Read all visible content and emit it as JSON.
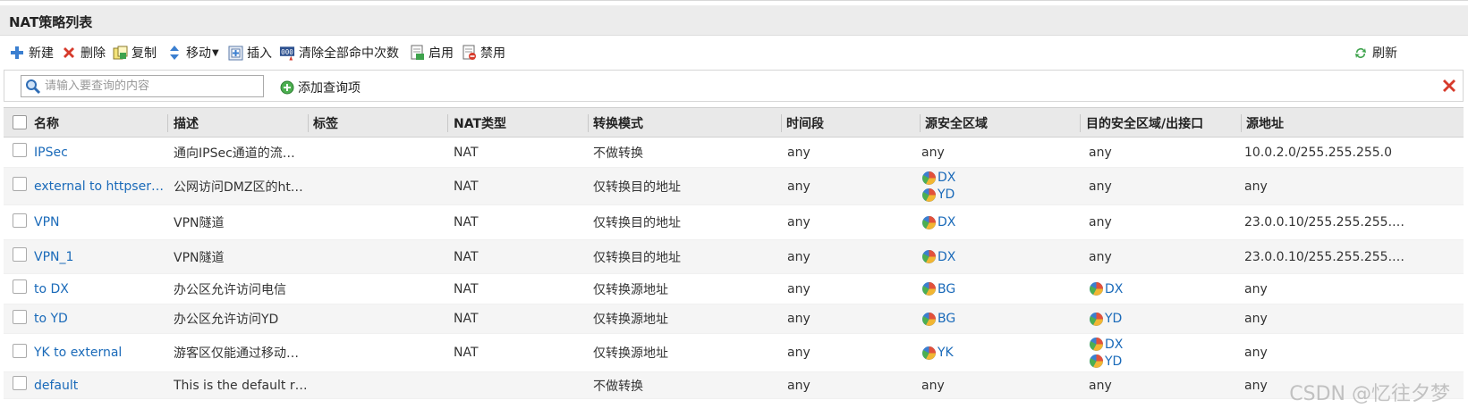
{
  "page_title": "NAT策略列表",
  "toolbar": {
    "new": "新建",
    "delete": "删除",
    "copy": "复制",
    "move": "移动",
    "insert": "插入",
    "clear_hits": "清除全部命中次数",
    "enable": "启用",
    "disable": "禁用",
    "refresh": "刷新"
  },
  "search": {
    "placeholder": "请输入要查询的内容",
    "add_query": "添加查询项"
  },
  "columns": [
    "名称",
    "描述",
    "标签",
    "NAT类型",
    "转换模式",
    "时间段",
    "源安全区域",
    "目的安全区域/出接口",
    "源地址"
  ],
  "rows": [
    {
      "name": "IPSec",
      "desc": "通向IPSec通道的流…",
      "tag": "",
      "nat_type": "NAT",
      "mode": "不做转换",
      "time": "any",
      "src_zone": "any",
      "dst_zone": "any",
      "src_addr": "10.0.2.0/255.255.255.0"
    },
    {
      "name": "external to httpserver",
      "desc": "公网访问DMZ区的ht…",
      "tag": "",
      "nat_type": "NAT",
      "mode": "仅转换目的地址",
      "time": "any",
      "src_zone": [
        "DX",
        "YD"
      ],
      "dst_zone": "any",
      "src_addr": "any"
    },
    {
      "name": "VPN",
      "desc": "VPN隧道",
      "tag": "",
      "nat_type": "NAT",
      "mode": "仅转换目的地址",
      "time": "any",
      "src_zone": [
        "DX"
      ],
      "dst_zone": "any",
      "src_addr": "23.0.0.10/255.255.255.…"
    },
    {
      "name": "VPN_1",
      "desc": "VPN隧道",
      "tag": "",
      "nat_type": "NAT",
      "mode": "仅转换目的地址",
      "time": "any",
      "src_zone": [
        "DX"
      ],
      "dst_zone": "any",
      "src_addr": "23.0.0.10/255.255.255.…"
    },
    {
      "name": "to DX",
      "desc": "办公区允许访问电信",
      "tag": "",
      "nat_type": "NAT",
      "mode": "仅转换源地址",
      "time": "any",
      "src_zone": [
        "BG"
      ],
      "dst_zone": [
        "DX"
      ],
      "src_addr": "any"
    },
    {
      "name": "to YD",
      "desc": "办公区允许访问YD",
      "tag": "",
      "nat_type": "NAT",
      "mode": "仅转换源地址",
      "time": "any",
      "src_zone": [
        "BG"
      ],
      "dst_zone": [
        "YD"
      ],
      "src_addr": "any"
    },
    {
      "name": "YK to external",
      "desc": "游客区仅能通过移动…",
      "tag": "",
      "nat_type": "NAT",
      "mode": "仅转换源地址",
      "time": "any",
      "src_zone": [
        "YK"
      ],
      "dst_zone": [
        "DX",
        "YD"
      ],
      "src_addr": "any"
    },
    {
      "name": "default",
      "desc": "This is the default rule",
      "tag": "",
      "nat_type": "",
      "mode": "不做转换",
      "time": "any",
      "src_zone": "any",
      "dst_zone": "any",
      "src_addr": "any"
    }
  ],
  "watermark": "CSDN @忆往夕梦"
}
